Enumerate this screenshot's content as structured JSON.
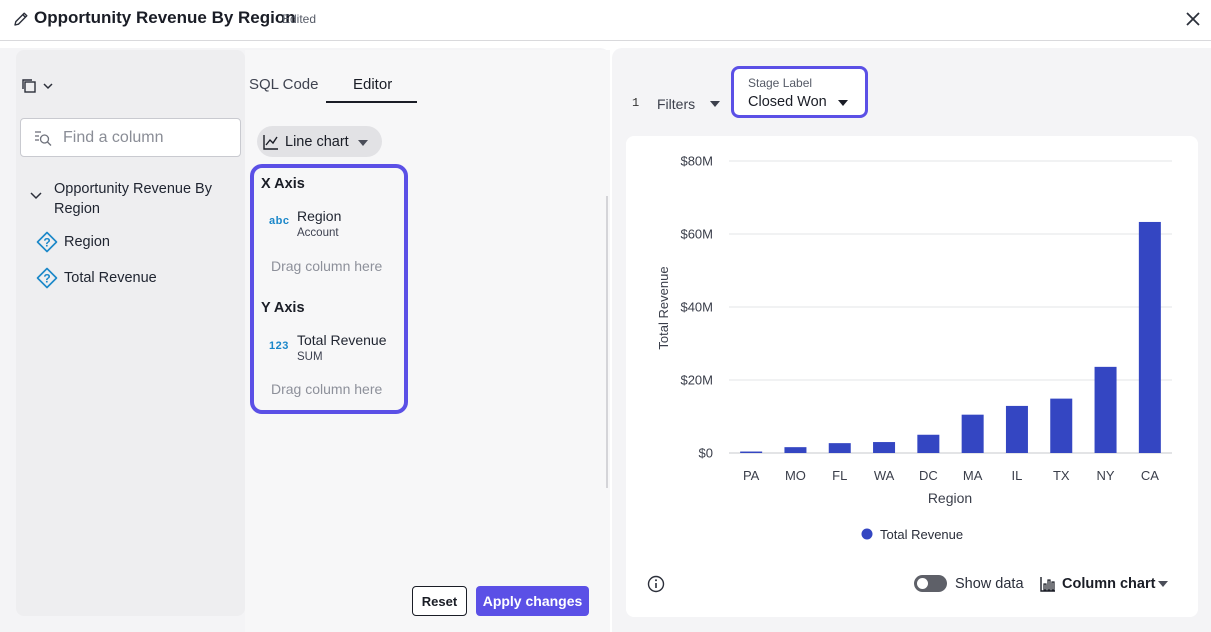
{
  "header": {
    "title": "Opportunity Revenue By Region",
    "status": "Edited"
  },
  "columns_panel": {
    "search_placeholder": "Find a column",
    "group_label": "Opportunity Revenue By Region",
    "fields": [
      "Region",
      "Total Revenue"
    ]
  },
  "tabs": {
    "sql": "SQL Code",
    "editor": "Editor",
    "active": "Editor"
  },
  "editor": {
    "chart_type": "Line chart",
    "x_axis": {
      "heading": "X Axis",
      "type_badge": "abc",
      "column": "Region",
      "source": "Account",
      "drop_hint": "Drag column here"
    },
    "y_axis": {
      "heading": "Y Axis",
      "type_badge": "123",
      "column": "Total Revenue",
      "aggregation": "SUM",
      "drop_hint": "Drag column here"
    },
    "reset_label": "Reset",
    "apply_label": "Apply changes"
  },
  "filters": {
    "count": "1",
    "label": "Filters",
    "stage_label": "Stage Label",
    "stage_value": "Closed Won"
  },
  "footer": {
    "show_data_label": "Show data",
    "show_data_on": false,
    "chart_type_label": "Column chart"
  },
  "colors": {
    "accent": "#5b50e6",
    "bar": "#3446c2",
    "type_badge": "#1b87c9"
  },
  "chart_data": {
    "type": "bar",
    "categories": [
      "PA",
      "MO",
      "FL",
      "WA",
      "DC",
      "MA",
      "IL",
      "TX",
      "NY",
      "CA"
    ],
    "series": [
      {
        "name": "Total Revenue",
        "values": [
          400000,
          1600000,
          2700000,
          3000000,
          5000000,
          10500000,
          12900000,
          14900000,
          23600000,
          63300000
        ]
      }
    ],
    "xlabel": "Region",
    "ylabel": "Total Revenue",
    "ylim": [
      0,
      80000000
    ],
    "yticks": [
      0,
      20000000,
      40000000,
      60000000,
      80000000
    ],
    "ytick_labels": [
      "$0",
      "$20M",
      "$40M",
      "$60M",
      "$80M"
    ],
    "grid": true,
    "legend": "bottom-center"
  }
}
